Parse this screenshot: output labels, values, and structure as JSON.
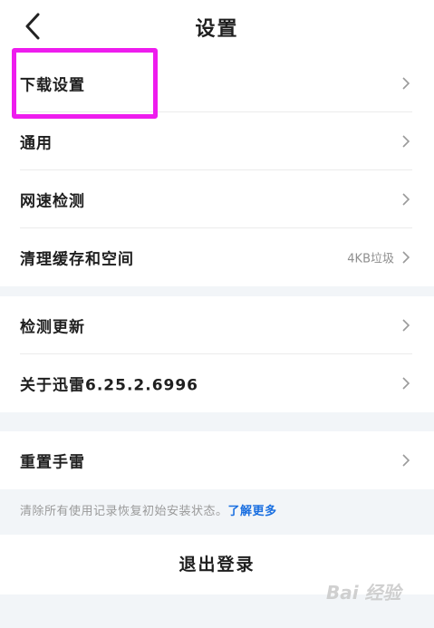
{
  "header": {
    "title": "设置"
  },
  "group1": [
    {
      "label": "下载设置",
      "value": ""
    },
    {
      "label": "通用",
      "value": ""
    },
    {
      "label": "网速检测",
      "value": ""
    },
    {
      "label": "清理缓存和空间",
      "value": "4KB垃圾"
    }
  ],
  "group2": [
    {
      "label": "检测更新",
      "value": ""
    },
    {
      "label": "关于迅雷6.25.2.6996",
      "value": ""
    }
  ],
  "group3": [
    {
      "label": "重置手雷",
      "value": ""
    }
  ],
  "reset_desc": {
    "text": "清除所有使用记录恢复初始安装状态。",
    "link": "了解更多"
  },
  "logout": {
    "label": "退出登录"
  },
  "watermark": {
    "text": "Bai 经验"
  },
  "colors": {
    "highlight": "#ee1cee",
    "link": "#1a6fe0",
    "background": "#f2f5f8"
  },
  "icons": {
    "back": "chevron-left-icon",
    "row": "chevron-right-icon"
  }
}
